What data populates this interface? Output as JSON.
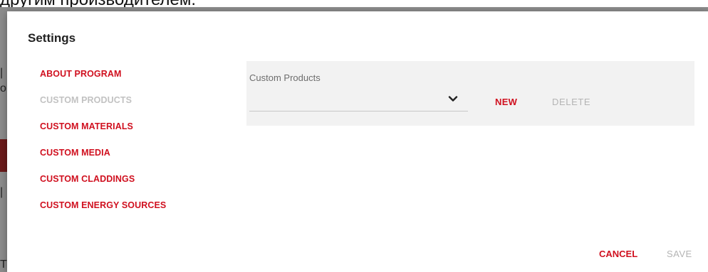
{
  "background": {
    "header_text": "другим производителем.",
    "left_glyphs": [
      "|",
      "o",
      "|",
      "T"
    ]
  },
  "dialog": {
    "title": "Settings",
    "nav_items": [
      {
        "label": "ABOUT PROGRAM",
        "active": false
      },
      {
        "label": "CUSTOM PRODUCTS",
        "active": true
      },
      {
        "label": "CUSTOM MATERIALS",
        "active": false
      },
      {
        "label": "CUSTOM MEDIA",
        "active": false
      },
      {
        "label": "CUSTOM CLADDINGS",
        "active": false
      },
      {
        "label": "CUSTOM ENERGY SOURCES",
        "active": false
      }
    ],
    "panel": {
      "field_label": "Custom Products",
      "select_value": "",
      "new_label": "NEW",
      "delete_label": "DELETE"
    },
    "footer": {
      "cancel_label": "CANCEL",
      "save_label": "SAVE"
    }
  },
  "colors": {
    "accent": "#d0101f",
    "disabled": "#b4b4b4",
    "panel_bg": "#f2f2f2"
  },
  "icons": {
    "select_chevron": "chevron-down-icon"
  }
}
